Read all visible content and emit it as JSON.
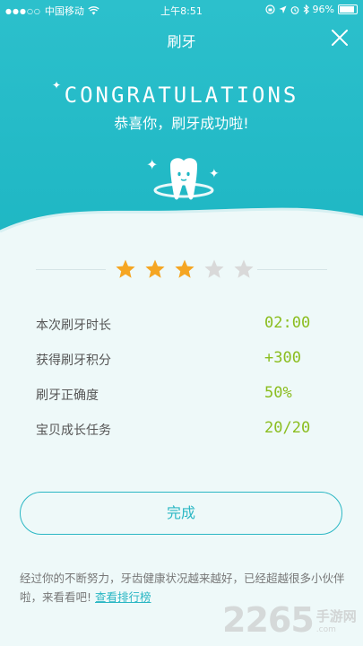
{
  "status_bar": {
    "signal": "●●●○○",
    "carrier": "中国移动",
    "time": "上午8:51",
    "battery": "96%"
  },
  "header": {
    "title": "刷牙",
    "close_icon": "close-icon"
  },
  "hero": {
    "headline": "CONGRATULATIONS",
    "subtitle": "恭喜你，刷牙成功啦!",
    "mascot_icon": "tooth-icon"
  },
  "rating": {
    "value": 3,
    "max": 5,
    "filled_color": "#f5a623",
    "empty_color": "#d9d9d9"
  },
  "stats": [
    {
      "label": "本次刷牙时长",
      "value": "02:00"
    },
    {
      "label": "获得刷牙积分",
      "value": "+300"
    },
    {
      "label": "刷牙正确度",
      "value": "50%"
    },
    {
      "label": "宝贝成长任务",
      "value": "20/20"
    }
  ],
  "actions": {
    "done_label": "完成"
  },
  "footer": {
    "message": "经过你的不断努力，牙齿健康状况越来越好，已经超越很多小伙伴啦，来看看吧!",
    "link_label": "查看排行榜"
  },
  "watermark": {
    "number": "2265",
    "cn": "手游网",
    "domain": ".com"
  },
  "colors": {
    "accent": "#2bb7c4",
    "value_green": "#8bbd1f"
  }
}
